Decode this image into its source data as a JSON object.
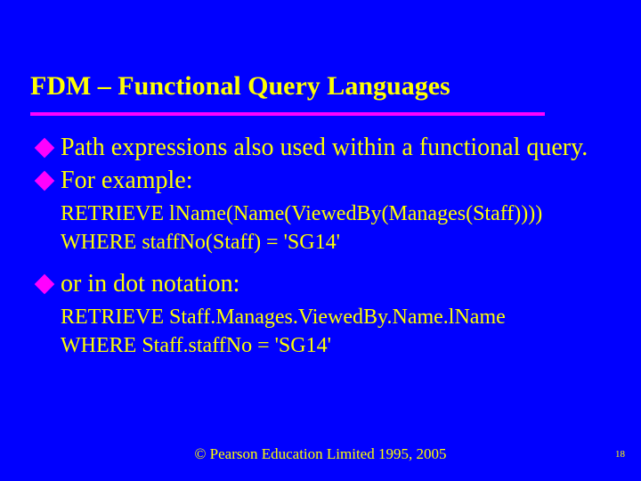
{
  "title": "FDM – Functional Query Languages",
  "bullets": {
    "b1": "Path expressions also used within a functional query.",
    "b2": "For example:",
    "b3": "or in dot notation:"
  },
  "code": {
    "c1a": "RETRIEVE lName(Name(ViewedBy(Manages(Staff))))",
    "c1b": "WHERE staffNo(Staff) = 'SG14'",
    "c2a": "RETRIEVE Staff.Manages.ViewedBy.Name.lName",
    "c2b": "WHERE Staff.staffNo = 'SG14'"
  },
  "footer": "© Pearson Education Limited 1995, 2005",
  "pagenum": "18"
}
